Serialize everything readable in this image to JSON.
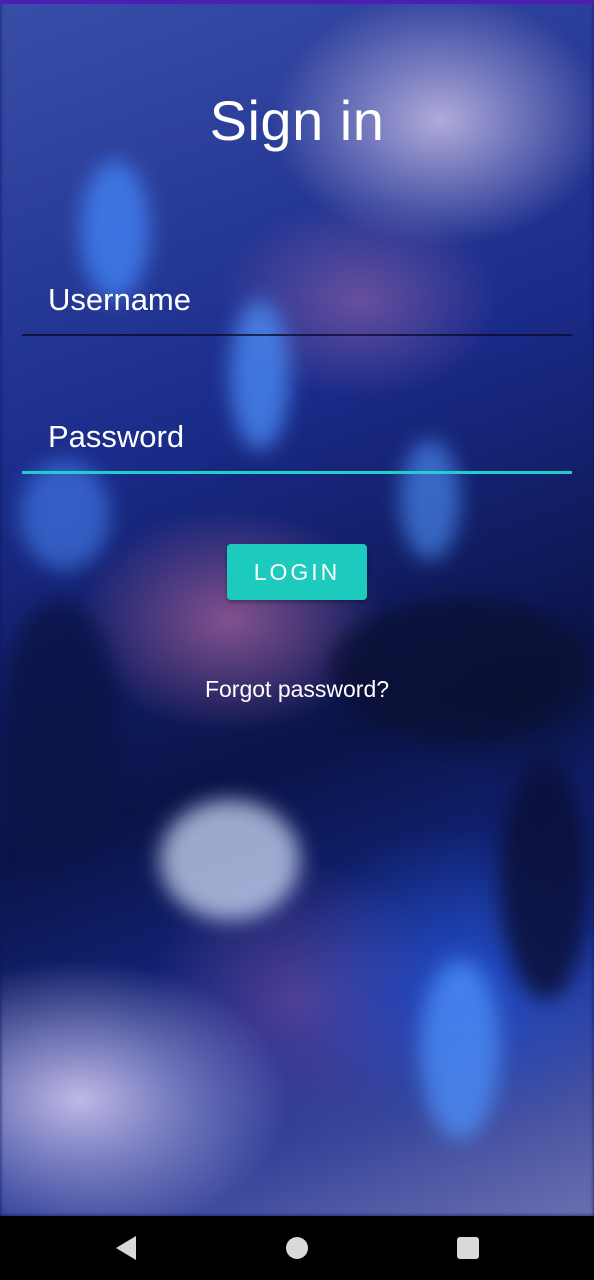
{
  "screen": {
    "title": "Sign in"
  },
  "form": {
    "username_placeholder": "Username",
    "password_placeholder": "Password",
    "login_label": "LOGIN",
    "forgot_label": "Forgot password?"
  },
  "colors": {
    "accent": "#1ccbbd",
    "status_strip": "#4b1fb3",
    "text": "#ffffff"
  },
  "nav": {
    "back_icon": "back-triangle-icon",
    "home_icon": "home-circle-icon",
    "recent_icon": "recent-square-icon"
  }
}
